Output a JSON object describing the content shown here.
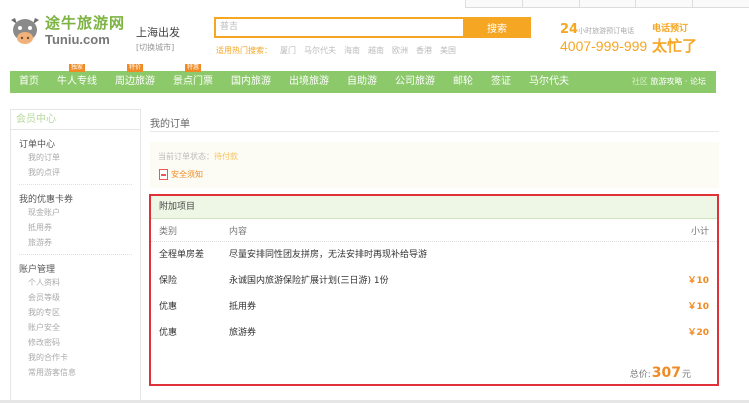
{
  "header": {
    "logo_cn": "途牛旅游网",
    "logo_en": "Tuniu.com",
    "city": "上海出发",
    "city_switch": "[切换城市]",
    "search_placeholder": "普吉",
    "search_button": "搜索",
    "hot_label": "适用热门搜索：",
    "hot_words": [
      "厦门",
      "马尔代夫",
      "海南",
      "越南",
      "欧洲",
      "香港",
      "美国"
    ],
    "hotline_top": "24",
    "hotline_top_text": "小时旅游预订电话",
    "hotline_number": "4007-999-999",
    "promo_line1": "电话预订",
    "promo_line2": "太忙了"
  },
  "nav": {
    "items": [
      {
        "label": "首页",
        "tag": ""
      },
      {
        "label": "牛人专线",
        "tag": "独家"
      },
      {
        "label": "周边旅游",
        "tag": "特价"
      },
      {
        "label": "景点门票",
        "tag": "特惠"
      },
      {
        "label": "国内旅游",
        "tag": ""
      },
      {
        "label": "出境旅游",
        "tag": ""
      },
      {
        "label": "自助游",
        "tag": ""
      },
      {
        "label": "公司旅游",
        "tag": ""
      },
      {
        "label": "邮轮",
        "tag": ""
      },
      {
        "label": "签证",
        "tag": ""
      },
      {
        "label": "马尔代夫",
        "tag": ""
      }
    ],
    "right_faded": "社区",
    "right_links": "旅游攻略 · 论坛"
  },
  "sidebar": {
    "title": "会员中心",
    "groups": [
      {
        "label": "订单中心",
        "items": [
          "我的订单",
          "我的点评"
        ]
      },
      {
        "label": "我的优惠卡券",
        "items": [
          "现金账户",
          "抵用券",
          "旅游券"
        ]
      },
      {
        "label": "账户管理",
        "items": [
          "个人资料",
          "会员等级",
          "我的专区",
          "账户安全",
          "修改密码",
          "我的合作卡",
          "常用游客信息"
        ]
      }
    ]
  },
  "main": {
    "title": "我的订单",
    "status_label": "当前订单状态：",
    "status_value": "待付款",
    "help_link": "安全须知"
  },
  "extras": {
    "title": "附加项目",
    "columns": {
      "type": "类别",
      "content": "内容",
      "subtotal": "小计"
    },
    "rows": [
      {
        "type": "全程单房差",
        "content": "尽量安排同性团友拼房，无法安排时再现补给导游",
        "subtotal": ""
      },
      {
        "type": "保险",
        "content": "永诚国内旅游保险扩展计划(三日游) 1份",
        "subtotal": "￥10"
      },
      {
        "type": "优惠",
        "content": "抵用券",
        "subtotal": "￥10"
      },
      {
        "type": "优惠",
        "content": "旅游券",
        "subtotal": "￥20"
      }
    ],
    "total_label": "总价:",
    "total_amount": "307",
    "total_unit": "元"
  },
  "colors": {
    "brand_green": "#8cc96b",
    "accent_orange": "#f5a623",
    "highlight_red": "#e0313a"
  }
}
